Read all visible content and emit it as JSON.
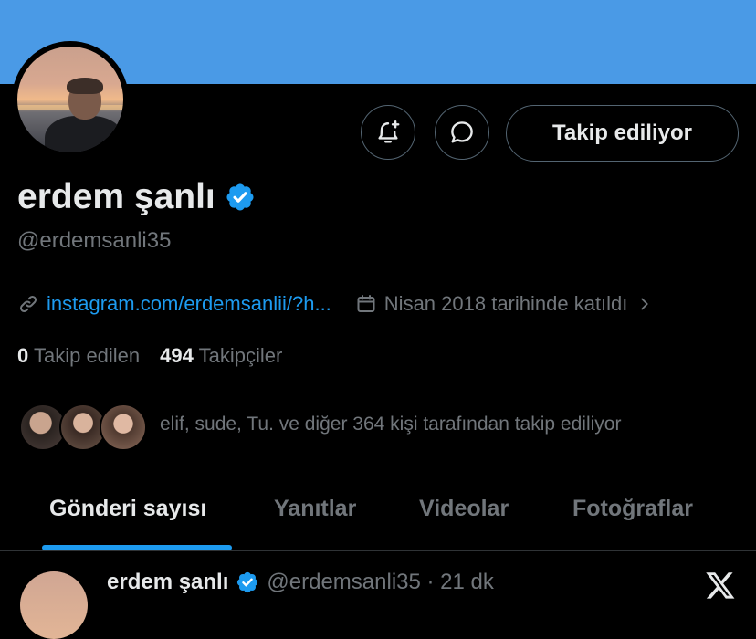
{
  "profile": {
    "name": "erdem şanlı",
    "handle": "@erdemsanli35",
    "link": "instagram.com/erdemsanlii/?h...",
    "joined": "Nisan 2018 tarihinde katıldı",
    "following_count": "0",
    "following_label": "Takip edilen",
    "followers_count": "494",
    "followers_label": "Takipçiler",
    "mutuals_text": "elif, sude, Tu. ve diğer 364 kişi tarafından takip ediliyor"
  },
  "actions": {
    "follow_label": "Takip ediliyor",
    "notify_icon": "bell-plus-icon",
    "message_icon": "chat-bubble-icon"
  },
  "tabs": [
    {
      "label": "Gönderi sayısı",
      "active": true
    },
    {
      "label": "Yanıtlar",
      "active": false
    },
    {
      "label": "Videolar",
      "active": false
    },
    {
      "label": "Fotoğraflar",
      "active": false
    }
  ],
  "post": {
    "name": "erdem şanlı",
    "handle_time": "@erdemsanli35 · 21 dk"
  },
  "colors": {
    "banner": "#4a9ae6",
    "accent": "#1d9bf0",
    "background": "#000000",
    "muted": "#71767b"
  }
}
